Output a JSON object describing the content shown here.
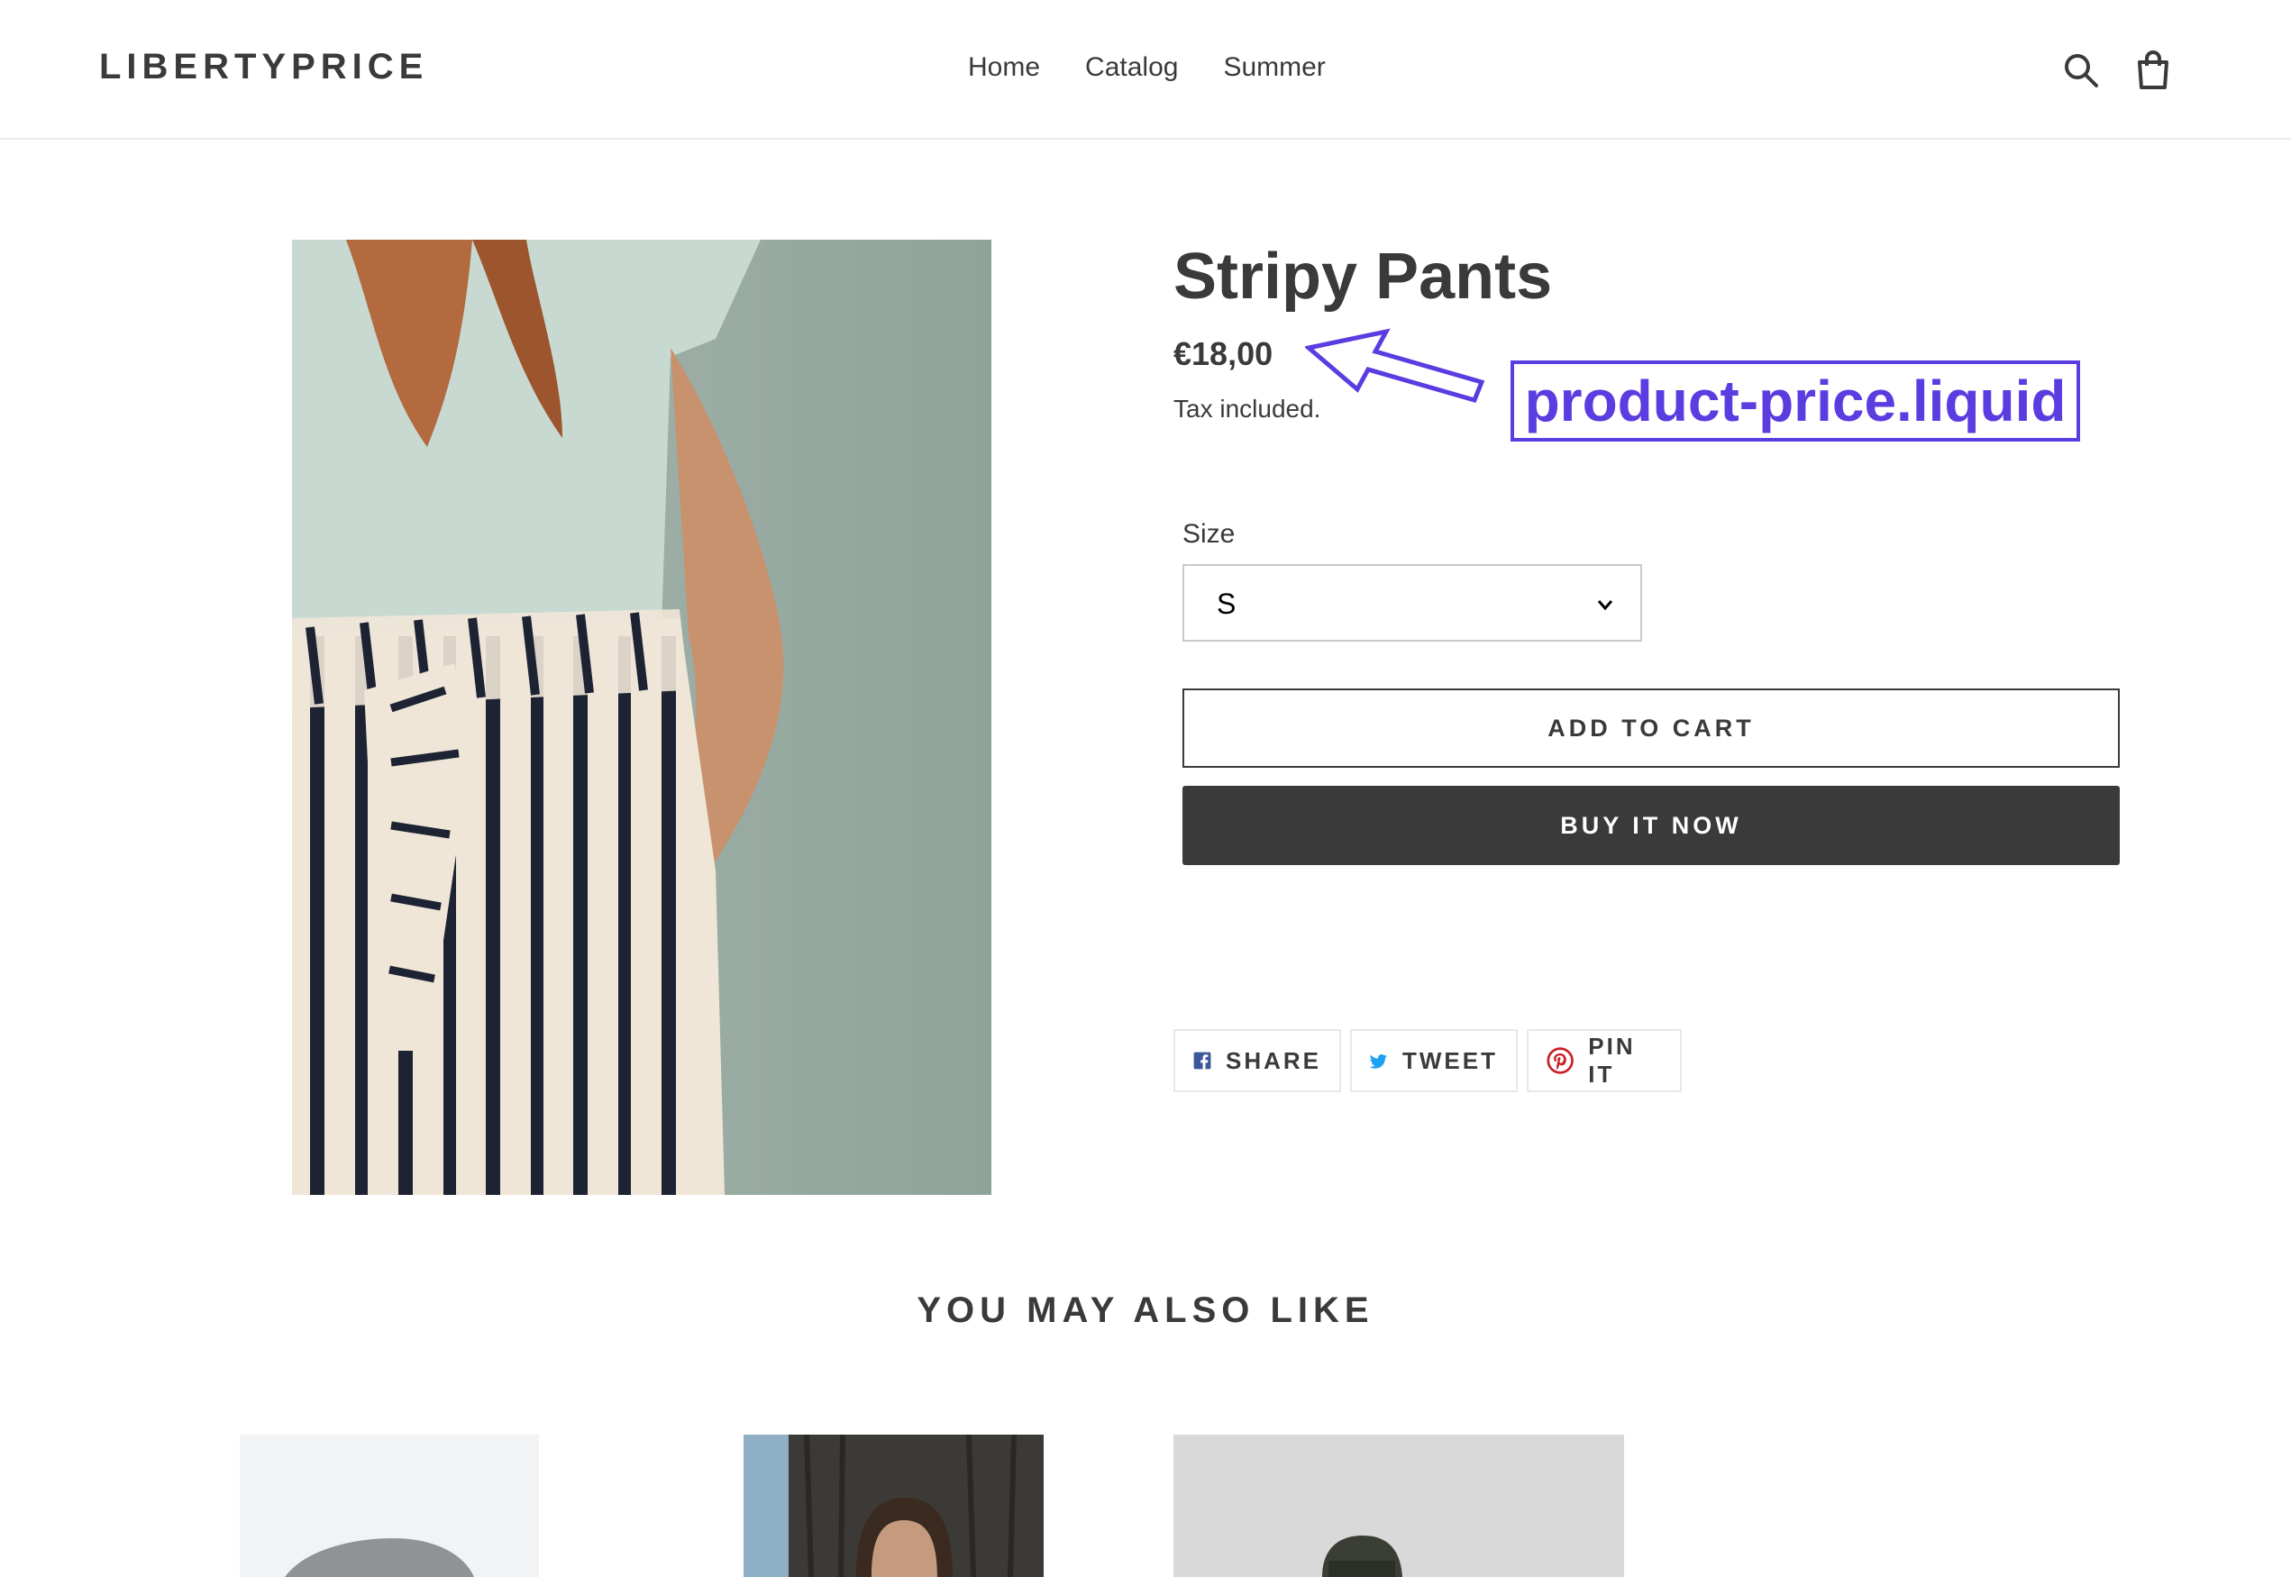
{
  "header": {
    "logo": "LIBERTYPRICE",
    "nav": [
      "Home",
      "Catalog",
      "Summer"
    ],
    "icons": [
      "search-icon",
      "cart-icon"
    ]
  },
  "product": {
    "title": "Stripy Pants",
    "price": "€18,00",
    "tax_note": "Tax included.",
    "size_label": "Size",
    "size_selected": "S",
    "add_to_cart": "ADD TO CART",
    "buy_now": "BUY IT NOW"
  },
  "annotation": {
    "label": "product-price.liquid",
    "color": "#5a3ce0"
  },
  "share": {
    "facebook": "SHARE",
    "twitter": "TWEET",
    "pinterest": "PIN IT"
  },
  "related": {
    "title": "YOU MAY ALSO LIKE"
  },
  "colors": {
    "text": "#3a3a3a",
    "button_dark": "#3a3a3a",
    "facebook": "#3b5998",
    "twitter": "#1da1f2",
    "pinterest": "#cb2027"
  }
}
